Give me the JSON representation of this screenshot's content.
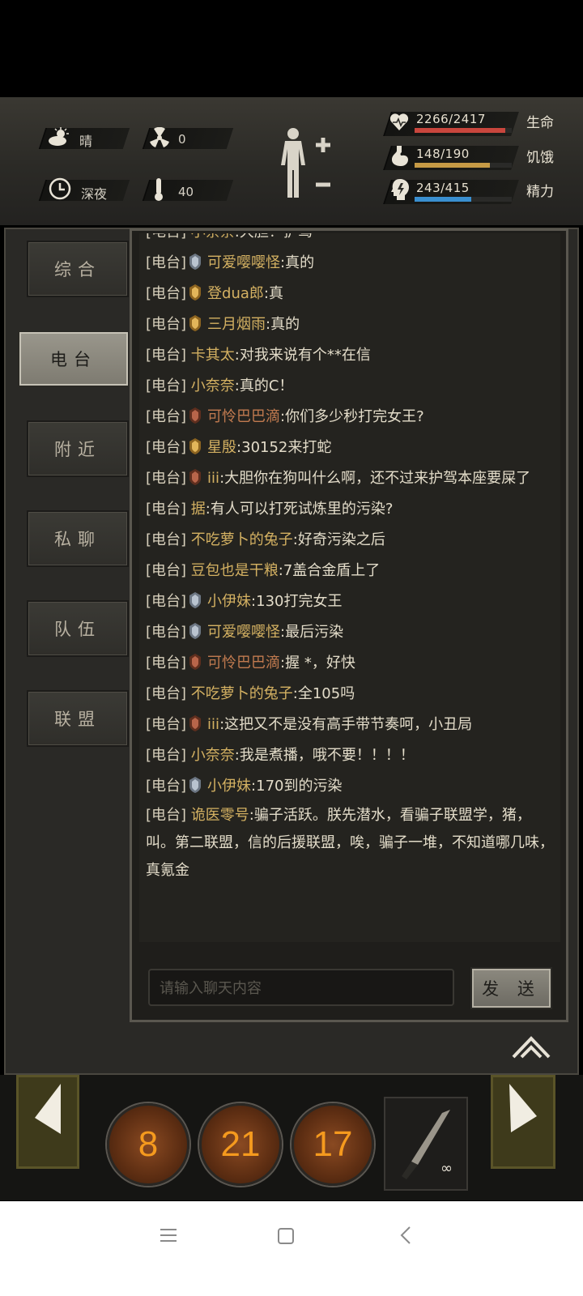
{
  "hud": {
    "weather": "晴",
    "radiation": "0",
    "time_of_day": "深夜",
    "temperature": "40",
    "stats": [
      {
        "value": "2266/2417",
        "name": "生命",
        "color": "#c9463d",
        "fill": 0.937
      },
      {
        "value": "148/190",
        "name": "饥饿",
        "color": "#c69a45",
        "fill": 0.779
      },
      {
        "value": "243/415",
        "name": "精力",
        "color": "#3a8fd0",
        "fill": 0.586
      }
    ]
  },
  "tabs": [
    "综合",
    "电台",
    "附近",
    "私聊",
    "队伍",
    "联盟"
  ],
  "active_tab": "电台",
  "chat": {
    "channel_label": "[电台]",
    "messages": [
      {
        "badge": "none",
        "name": "小奈奈",
        "text": ":大胆！护驾",
        "name_color": "gold"
      },
      {
        "badge": "silver",
        "name": "可爱嘤嘤怪",
        "text": ":真的",
        "name_color": "gold"
      },
      {
        "badge": "gold",
        "name": "登dua郎",
        "text": ":真",
        "name_color": "gold"
      },
      {
        "badge": "gold",
        "name": "三月烟雨",
        "text": ":真的",
        "name_color": "gold"
      },
      {
        "badge": "none",
        "name": "卡其太",
        "text": ":对我来说有个**在信",
        "name_color": "gold"
      },
      {
        "badge": "none",
        "name": "小奈奈",
        "text": ":真的C！",
        "name_color": "gold"
      },
      {
        "badge": "bronze",
        "name": "可怜巴巴滴",
        "text": ":你们多少秒打完女王?",
        "name_color": "red"
      },
      {
        "badge": "gold",
        "name": "星殷",
        "text": ":30152来打蛇",
        "name_color": "gold"
      },
      {
        "badge": "bronze",
        "name": "iii",
        "text": ":大胆你在狗叫什么啊，还不过来护驾本座要屎了",
        "name_color": "gold"
      },
      {
        "badge": "none",
        "name": "据",
        "text": ":有人可以打死试炼里的污染?",
        "name_color": "gold"
      },
      {
        "badge": "none",
        "name": "不吃萝卜的兔子",
        "text": ":好奇污染之后",
        "name_color": "gold"
      },
      {
        "badge": "none",
        "name": "豆包也是干粮",
        "text": ":7盖合金盾上了",
        "name_color": "gold"
      },
      {
        "badge": "silver",
        "name": "小伊妹",
        "text": ":130打完女王",
        "name_color": "gold"
      },
      {
        "badge": "silver",
        "name": "可爱嘤嘤怪",
        "text": ":最后污染",
        "name_color": "gold"
      },
      {
        "badge": "bronze",
        "name": "可怜巴巴滴",
        "text": ":握 *，好快",
        "name_color": "red"
      },
      {
        "badge": "none",
        "name": "不吃萝卜的兔子",
        "text": ":全105吗",
        "name_color": "gold"
      },
      {
        "badge": "bronze",
        "name": "iii",
        "text": ":这把又不是没有高手带节奏呵，小丑局",
        "name_color": "gold"
      },
      {
        "badge": "none",
        "name": "小奈奈",
        "text": ":我是煮播，哦不要！！！！",
        "name_color": "gold"
      },
      {
        "badge": "silver",
        "name": "小伊妹",
        "text": ":170到的污染",
        "name_color": "gold"
      },
      {
        "badge": "none",
        "name": "诡医零号",
        "text": ":骗子活跃。朕先潜水，看骗子联盟学，猪，叫。第二联盟，信的后援联盟，唉，骗子一堆，不知道哪几味，真氪金",
        "name_color": "gold"
      }
    ],
    "input_placeholder": "请输入聊天内容",
    "send_label": "发 送"
  },
  "skills": [
    "8",
    "21",
    "17"
  ],
  "weapon_count": "∞"
}
